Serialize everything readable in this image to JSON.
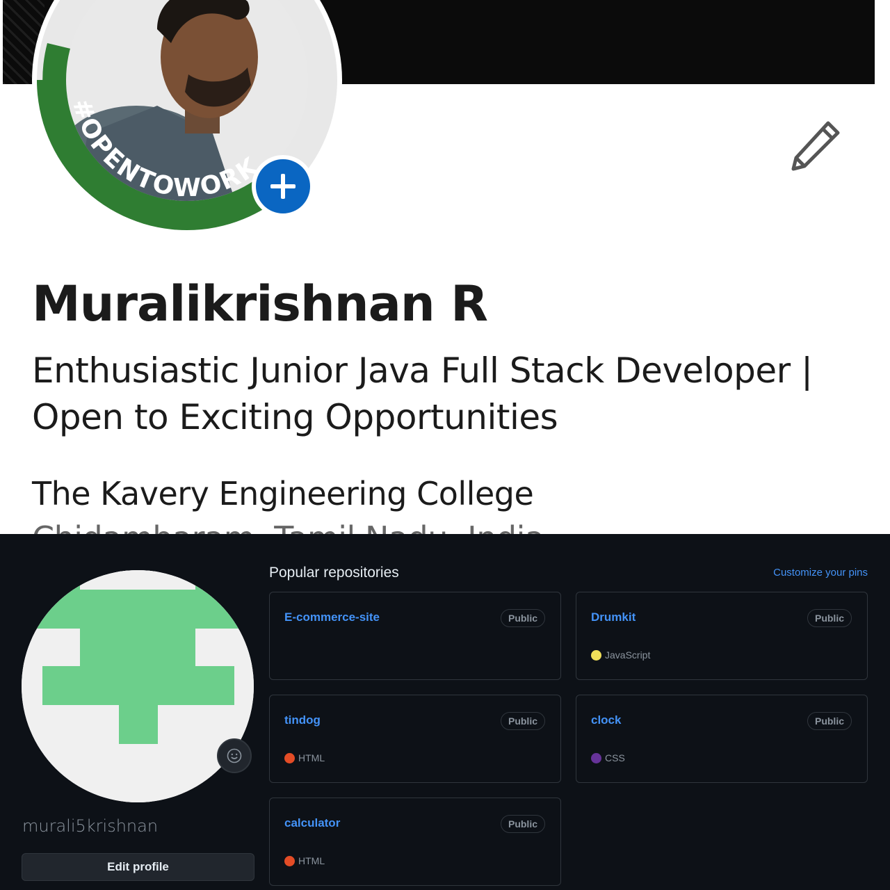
{
  "linkedin": {
    "avatar_banner": "#OPENTOWORK",
    "name": "Muralikrishnan R",
    "headline": "Enthusiastic Junior Java Full Stack Developer | Open to Exciting Opportunities",
    "school": "The Kavery Engineering College",
    "location": "Chidambaram, Tamil Nadu, India",
    "colors": {
      "open_to_work_green": "#2f7d32",
      "plus_blue": "#0a66c2"
    },
    "icons": {
      "add": "plus-icon",
      "edit": "pencil-icon"
    }
  },
  "github": {
    "username": "murali5krishnan",
    "edit_profile_label": "Edit profile",
    "popular_title": "Popular repositories",
    "customize_label": "Customize your pins",
    "status_icon": "smiley-icon",
    "identicon_color": "#6ccf8b",
    "repos": [
      {
        "name": "E-commerce-site",
        "visibility": "Public",
        "language": "",
        "lang_color": ""
      },
      {
        "name": "Drumkit",
        "visibility": "Public",
        "language": "JavaScript",
        "lang_color": "#f1e05a"
      },
      {
        "name": "tindog",
        "visibility": "Public",
        "language": "HTML",
        "lang_color": "#e34c26"
      },
      {
        "name": "clock",
        "visibility": "Public",
        "language": "CSS",
        "lang_color": "#663399"
      },
      {
        "name": "calculator",
        "visibility": "Public",
        "language": "HTML",
        "lang_color": "#e34c26"
      }
    ]
  }
}
